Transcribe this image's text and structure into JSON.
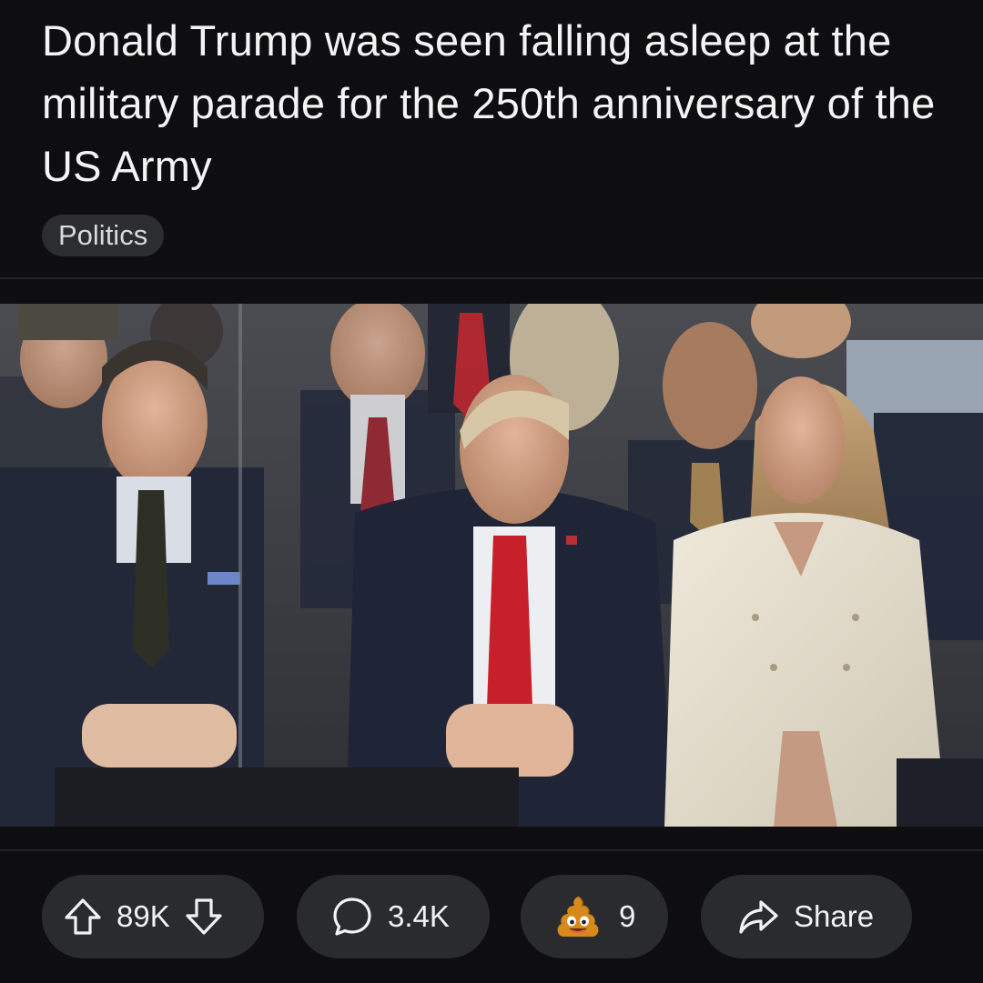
{
  "post": {
    "title": "Donald Trump was seen falling asleep at the military parade for the 250th anniversary of the US Army",
    "flair": "Politics"
  },
  "media": {
    "description_icon": "photo-image",
    "colors": {
      "background": "#3a3c42",
      "suit_dark": "#1f2433",
      "tie_red": "#c8202a",
      "coat_cream": "#e8e2d3"
    }
  },
  "actions": {
    "upvote_icon": "arrow-up-icon",
    "vote_count": "89K",
    "downvote_icon": "arrow-down-icon",
    "comment_icon": "speech-bubble-icon",
    "comment_count": "3.4K",
    "award_icon": "poop-emoji-icon",
    "award_count": "9",
    "share_icon": "share-arrow-icon",
    "share_label": "Share"
  },
  "theme": {
    "background": "#0e0e10",
    "pill_bg": "#2a2b2e",
    "text": "#f2f2f2"
  }
}
